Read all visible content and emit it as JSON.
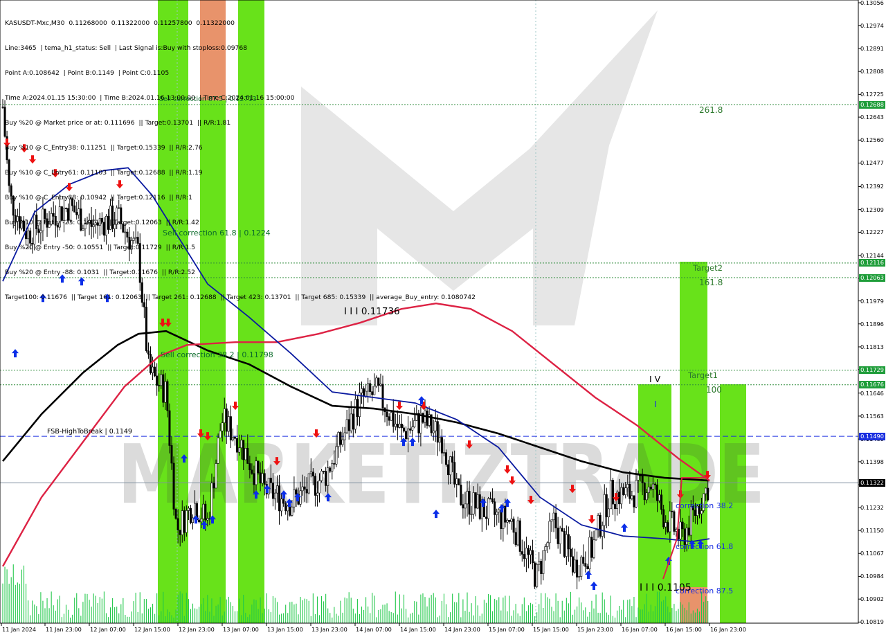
{
  "header": {
    "lines": [
      "KASUSDT-Mxc,M30  0.11268000  0.11322000  0.11257800  0.11322000",
      "Line:3465  | tema_h1_status: Sell  | Last Signal is:Buy with stoploss:0.09768",
      "Point A:0.108642  | Point B:0.1149  | Point C:0.1105",
      "Time A:2024.01.15 15:30:00  | Time B:2024.01.16 13:00:00  | Time C:2024.01.16 15:00:00",
      "Buy %20 @ Market price or at: 0.111696  || Target:0.13701  || R/R:1.81",
      "Buy %10 @ C_Entry38: 0.11251  || Target:0.15339  || R/R:2.76",
      "Buy %10 @ C_Entry61: 0.11103  || Target:0.12688  || R/R:1.19",
      "Buy %10 @ C_Entry88: 0.10942  || Target:0.12116  || R/R:1",
      "Buy %10 @ Entry -23: 0.10717  || Target:0.12063  || R/R:1.42",
      "Buy %20 @ Entry -50: 0.10551  || Target:0.11729  || R/R:1.5",
      "Buy %20 @ Entry -88: 0.1031  || Target:0.11676  || R/R:2.52",
      "Target100: 0.11676  || Target 161: 0.12063  || Target 261: 0.12688  || Target 423: 0.13701  || Target 685: 0.15339  || average_Buy_entry: 0.1080742"
    ]
  },
  "chart_data": {
    "type": "candlestick",
    "symbol": "KASUSDT-Mxc",
    "timeframe": "M30",
    "ylim": [
      0.10815,
      0.13066
    ],
    "y_ticks": [
      "0.13056",
      "0.12974",
      "0.12891",
      "0.12808",
      "0.12725",
      "0.12643",
      "0.12560",
      "0.12477",
      "0.12392",
      "0.12309",
      "0.12227",
      "0.12144",
      "0.12061",
      "0.11979",
      "0.11896",
      "0.11813",
      "0.11731",
      "0.11646",
      "0.11563",
      "0.11480",
      "0.11398",
      "0.11315",
      "0.11232",
      "0.11150",
      "0.11067",
      "0.10984",
      "0.10902",
      "0.10819"
    ],
    "x_ticks": [
      "11 Jan 2024",
      "11 Jan 23:00",
      "12 Jan 07:00",
      "12 Jan 15:00",
      "12 Jan 23:00",
      "13 Jan 07:00",
      "13 Jan 15:00",
      "13 Jan 23:00",
      "14 Jan 07:00",
      "14 Jan 15:00",
      "14 Jan 23:00",
      "15 Jan 07:00",
      "15 Jan 15:00",
      "15 Jan 23:00",
      "16 Jan 07:00",
      "16 Jan 15:00",
      "16 Jan 23:00"
    ],
    "price_labels": [
      {
        "value": "0.12688",
        "color": "#1f9d3a"
      },
      {
        "value": "0.12116",
        "color": "#1f9d3a"
      },
      {
        "value": "0.12063",
        "color": "#1f9d3a"
      },
      {
        "value": "0.11729",
        "color": "#1f9d3a"
      },
      {
        "value": "0.11676",
        "color": "#1f9d3a"
      },
      {
        "value": "0.11490",
        "color": "#1a2fe0"
      },
      {
        "value": "0.11322",
        "color": "#000000"
      }
    ],
    "horizontal_levels": [
      {
        "value": 0.12688,
        "style": "dotted",
        "color": "#2e8b3a"
      },
      {
        "value": 0.12116,
        "style": "dotted",
        "color": "#2e8b3a"
      },
      {
        "value": 0.12063,
        "style": "dotted",
        "color": "#2e8b3a"
      },
      {
        "value": 0.11729,
        "style": "dotted",
        "color": "#2e8b3a"
      },
      {
        "value": 0.11676,
        "style": "dotted",
        "color": "#2e8b3a"
      },
      {
        "value": 0.1149,
        "style": "dashed",
        "color": "#1a2fe0"
      },
      {
        "value": 0.11322,
        "style": "solid",
        "color": "#8090a0"
      }
    ],
    "annotations": {
      "target_261": "261.8",
      "target2": "Target2",
      "target_161": "161.8",
      "iii_level": "I I I 0.11736",
      "target1": "Target1",
      "target_100": "100",
      "iv_label": "I V",
      "i_label": "I",
      "sell_correction_618": "Sell correction 61.8 | 0.1224",
      "sell_correction_382": "Sell correction 38.2 | 0.11798",
      "sell_correction_875": "Sell correction 87.5 | 0.12713",
      "fsb": "FSB-HighToBreak  | 0.1149",
      "correction_382": "correction 38.2",
      "correction_618": "correction 61.8",
      "correction_875": "correction 87.5",
      "iii_low": "I I I 0.1105"
    },
    "watermark": "MARKETIZTRADE",
    "colors": {
      "bull_bar": "#68e21a",
      "bear_bar": "#e8936b",
      "ma_black": "#000000",
      "ma_red": "#dd2244",
      "ma_blue": "#0a1aa0",
      "up_arrow": "#0a2ee8",
      "down_arrow": "#ee1111",
      "candle": "#000000",
      "volume": "#22c84a"
    }
  }
}
